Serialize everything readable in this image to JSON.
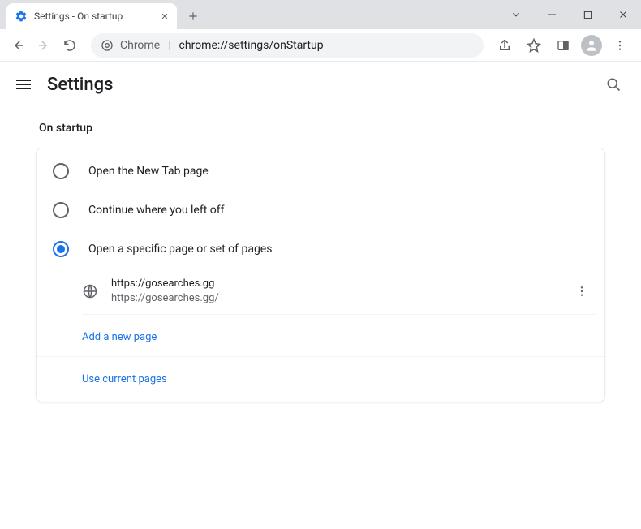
{
  "window": {
    "tab_title": "Settings - On startup"
  },
  "toolbar": {
    "url_prefix": "Chrome",
    "url_path": "chrome://settings/onStartup"
  },
  "header": {
    "title": "Settings"
  },
  "section": {
    "title": "On startup",
    "options": [
      {
        "label": "Open the New Tab page",
        "selected": false
      },
      {
        "label": "Continue where you left off",
        "selected": false
      },
      {
        "label": "Open a specific page or set of pages",
        "selected": true
      }
    ],
    "pages": [
      {
        "title": "https://gosearches.gg",
        "url": "https://gosearches.gg/"
      }
    ],
    "add_label": "Add a new page",
    "use_current_label": "Use current pages"
  }
}
